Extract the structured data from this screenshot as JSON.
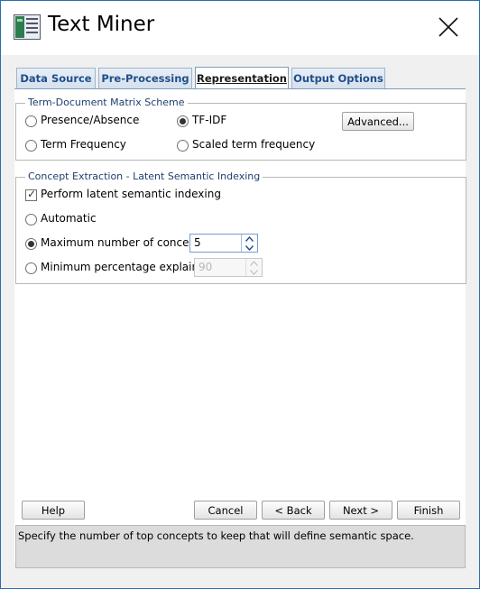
{
  "window": {
    "title": "Text Miner",
    "accent": "#2b6cb0"
  },
  "tabs": [
    {
      "label": "Data Source",
      "active": false
    },
    {
      "label": "Pre-Processing",
      "active": false
    },
    {
      "label": "Representation",
      "active": true
    },
    {
      "label": "Output Options",
      "active": false
    }
  ],
  "tdm": {
    "legend": "Term-Document Matrix Scheme",
    "presence_absence": "Presence/Absence",
    "tf_idf": "TF-IDF",
    "term_frequency": "Term Frequency",
    "scaled_term_frequency": "Scaled term frequency",
    "advanced_button": "Advanced...",
    "selected": "TF-IDF"
  },
  "lsi": {
    "legend": "Concept Extraction - Latent Semantic Indexing",
    "perform_label": "Perform latent semantic indexing",
    "perform_checked": true,
    "automatic_label": "Automatic",
    "max_concepts_label": "Maximum number of concepts:",
    "max_concepts_value": "5",
    "min_pct_label": "Minimum percentage explained:",
    "min_pct_value": "90",
    "selected": "Maximum number of concepts"
  },
  "buttons": {
    "help": "Help",
    "cancel": "Cancel",
    "back": "< Back",
    "next": "Next >",
    "finish": "Finish"
  },
  "status_text": "Specify the number of top concepts to keep that will define semantic space."
}
